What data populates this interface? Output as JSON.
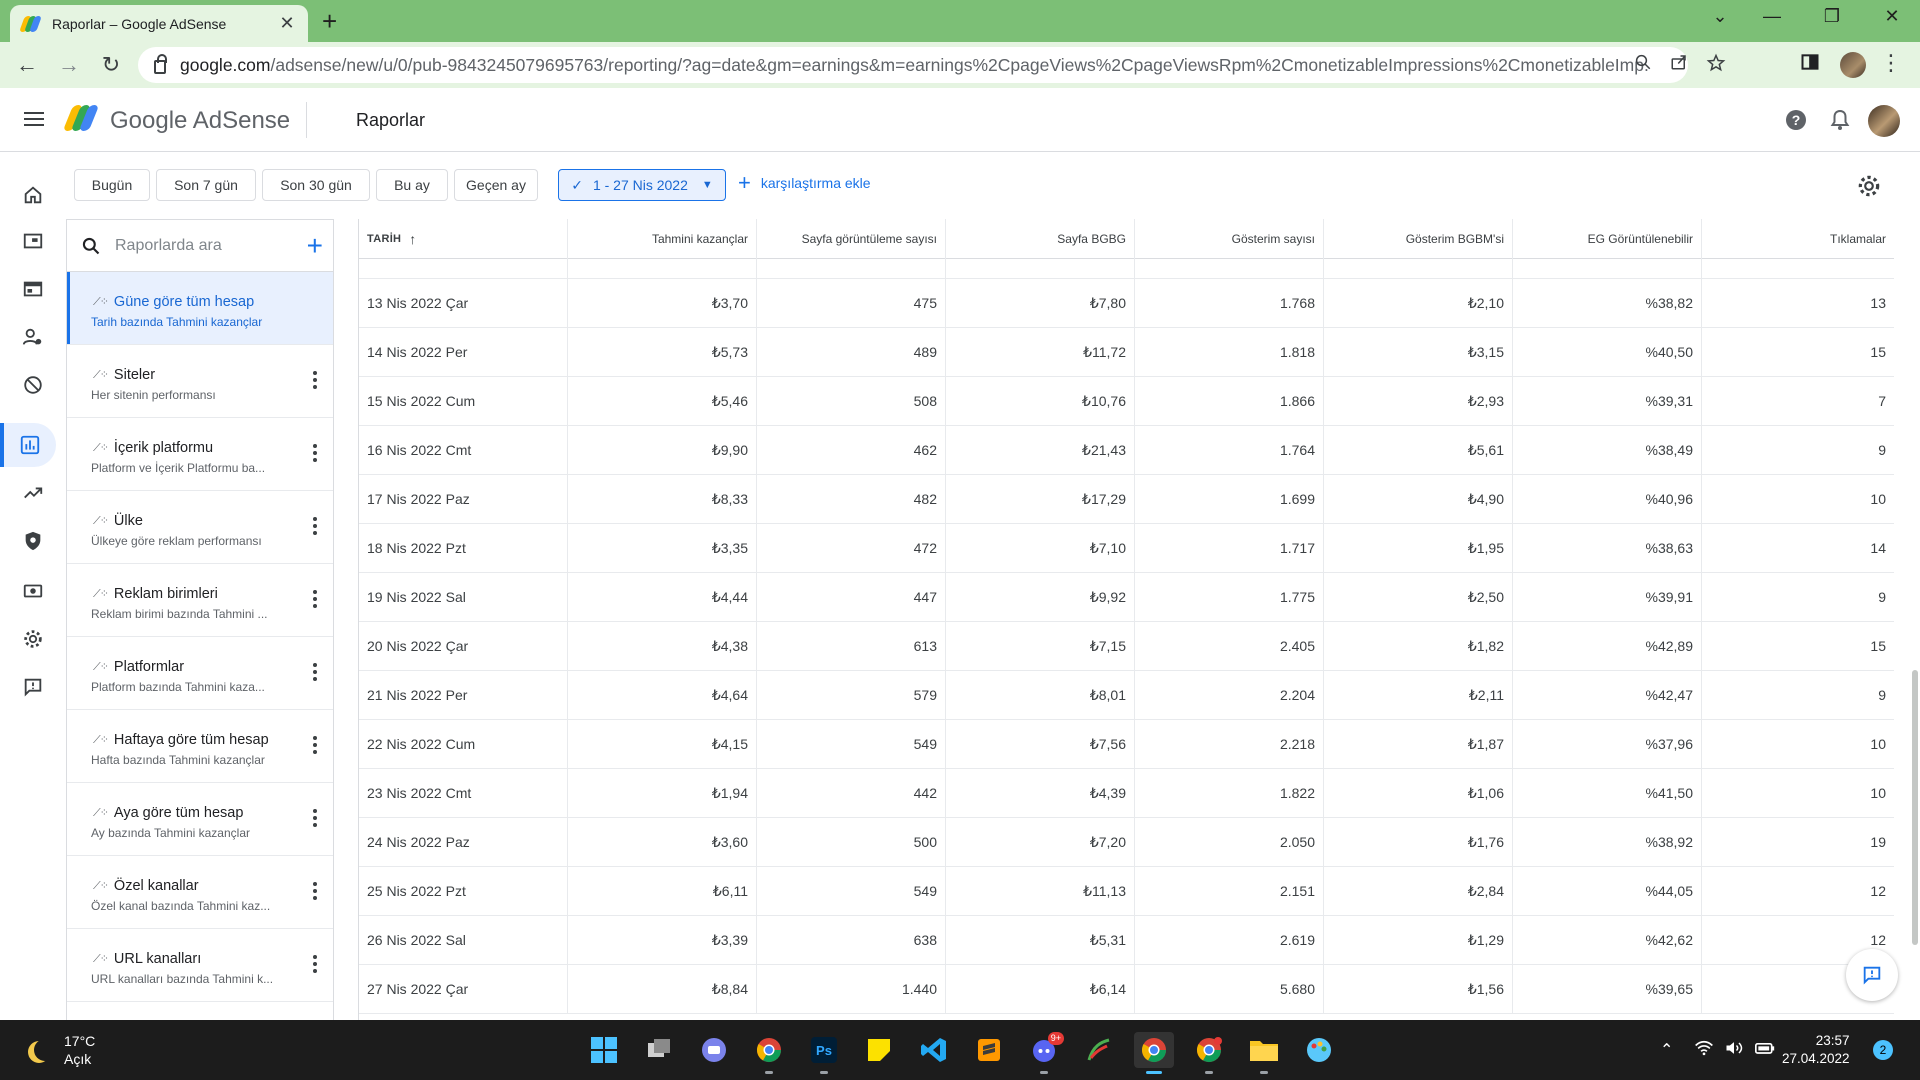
{
  "browser": {
    "tab_title": "Raporlar – Google AdSense",
    "url_host": "google.com",
    "url_path": "/adsense/new/u/0/pub-9843245079695763/reporting/?ag=date&gm=earnings&m=earnings%2CpageViews%2CpageViewsRpm%2CmonetizableImpressions%2CmonetizableImp..."
  },
  "app": {
    "brand": "Google AdSense",
    "page_title": "Raporlar"
  },
  "filters": {
    "chips": [
      "Bugün",
      "Son 7 gün",
      "Son 30 gün",
      "Bu ay",
      "Geçen ay"
    ],
    "selected_range": "1 - 27 Nis 2022",
    "add_comparison": "karşılaştırma ekle"
  },
  "reports": {
    "search_placeholder": "Raporlarda ara",
    "items": [
      {
        "title": "Güne göre tüm hesap",
        "subtitle": "Tarih bazında Tahmini kazançlar"
      },
      {
        "title": "Siteler",
        "subtitle": "Her sitenin performansı"
      },
      {
        "title": "İçerik platformu",
        "subtitle": "Platform ve İçerik Platformu ba..."
      },
      {
        "title": "Ülke",
        "subtitle": "Ülkeye göre reklam performansı"
      },
      {
        "title": "Reklam birimleri",
        "subtitle": "Reklam birimi bazında Tahmini ..."
      },
      {
        "title": "Platformlar",
        "subtitle": "Platform bazında Tahmini kaza..."
      },
      {
        "title": "Haftaya göre tüm hesap",
        "subtitle": "Hafta bazında Tahmini kazançlar"
      },
      {
        "title": "Aya göre tüm hesap",
        "subtitle": "Ay bazında Tahmini kazançlar"
      },
      {
        "title": "Özel kanallar",
        "subtitle": "Özel kanal bazında Tahmini kaz..."
      },
      {
        "title": "URL kanalları",
        "subtitle": "URL kanalları bazında Tahmini k..."
      }
    ]
  },
  "table": {
    "columns": [
      "TARİH",
      "Tahmini kazançlar",
      "Sayfa görüntüleme sayısı",
      "Sayfa BGBG",
      "Gösterim sayısı",
      "Gösterim BGBM'si",
      "EG Görüntülenebilir",
      "Tıklamalar"
    ],
    "rows": [
      [
        "13 Nis 2022 Çar",
        "₺3,70",
        "475",
        "₺7,80",
        "1.768",
        "₺2,10",
        "%38,82",
        "13"
      ],
      [
        "14 Nis 2022 Per",
        "₺5,73",
        "489",
        "₺11,72",
        "1.818",
        "₺3,15",
        "%40,50",
        "15"
      ],
      [
        "15 Nis 2022 Cum",
        "₺5,46",
        "508",
        "₺10,76",
        "1.866",
        "₺2,93",
        "%39,31",
        "7"
      ],
      [
        "16 Nis 2022 Cmt",
        "₺9,90",
        "462",
        "₺21,43",
        "1.764",
        "₺5,61",
        "%38,49",
        "9"
      ],
      [
        "17 Nis 2022 Paz",
        "₺8,33",
        "482",
        "₺17,29",
        "1.699",
        "₺4,90",
        "%40,96",
        "10"
      ],
      [
        "18 Nis 2022 Pzt",
        "₺3,35",
        "472",
        "₺7,10",
        "1.717",
        "₺1,95",
        "%38,63",
        "14"
      ],
      [
        "19 Nis 2022 Sal",
        "₺4,44",
        "447",
        "₺9,92",
        "1.775",
        "₺2,50",
        "%39,91",
        "9"
      ],
      [
        "20 Nis 2022 Çar",
        "₺4,38",
        "613",
        "₺7,15",
        "2.405",
        "₺1,82",
        "%42,89",
        "15"
      ],
      [
        "21 Nis 2022 Per",
        "₺4,64",
        "579",
        "₺8,01",
        "2.204",
        "₺2,11",
        "%42,47",
        "9"
      ],
      [
        "22 Nis 2022 Cum",
        "₺4,15",
        "549",
        "₺7,56",
        "2.218",
        "₺1,87",
        "%37,96",
        "10"
      ],
      [
        "23 Nis 2022 Cmt",
        "₺1,94",
        "442",
        "₺4,39",
        "1.822",
        "₺1,06",
        "%41,50",
        "10"
      ],
      [
        "24 Nis 2022 Paz",
        "₺3,60",
        "500",
        "₺7,20",
        "2.050",
        "₺1,76",
        "%38,92",
        "19"
      ],
      [
        "25 Nis 2022 Pzt",
        "₺6,11",
        "549",
        "₺11,13",
        "2.151",
        "₺2,84",
        "%44,05",
        "12"
      ],
      [
        "26 Nis 2022 Sal",
        "₺3,39",
        "638",
        "₺5,31",
        "2.619",
        "₺1,29",
        "%42,62",
        "12"
      ],
      [
        "27 Nis 2022 Çar",
        "₺8,84",
        "1.440",
        "₺6,14",
        "5.680",
        "₺1,56",
        "%39,65",
        ""
      ]
    ]
  },
  "taskbar": {
    "temperature": "17°C",
    "weather": "Açık",
    "time": "23:57",
    "date": "27.04.2022",
    "notifications": "2",
    "discord_badge": "9+"
  },
  "colors": {
    "chrome_frame": "#7cbf76",
    "chrome_toolbar": "#e5f4e1",
    "accent": "#1a73e8",
    "selected_bg": "#e8f0fe"
  }
}
